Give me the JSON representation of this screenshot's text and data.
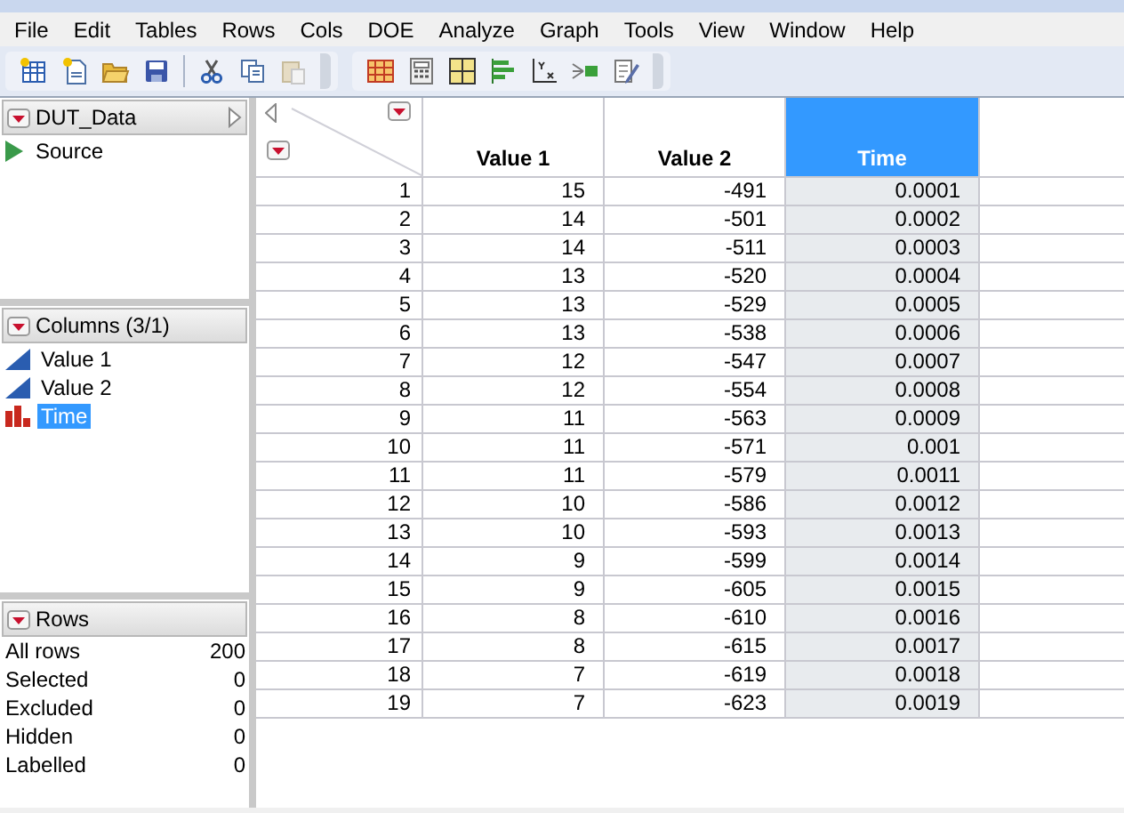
{
  "menu": [
    "File",
    "Edit",
    "Tables",
    "Rows",
    "Cols",
    "DOE",
    "Analyze",
    "Graph",
    "Tools",
    "View",
    "Window",
    "Help"
  ],
  "table_panel": {
    "title": "DUT_Data",
    "items": [
      {
        "label": "Source"
      }
    ]
  },
  "columns_panel": {
    "title": "Columns (3/1)",
    "columns": [
      {
        "label": "Value 1",
        "kind": "continuous",
        "selected": false
      },
      {
        "label": "Value 2",
        "kind": "continuous",
        "selected": false
      },
      {
        "label": "Time",
        "kind": "ordinal",
        "selected": true
      }
    ]
  },
  "rows_panel": {
    "title": "Rows",
    "stats": [
      {
        "label": "All rows",
        "value": "200"
      },
      {
        "label": "Selected",
        "value": "0"
      },
      {
        "label": "Excluded",
        "value": "0"
      },
      {
        "label": "Hidden",
        "value": "0"
      },
      {
        "label": "Labelled",
        "value": "0"
      }
    ]
  },
  "table": {
    "columns": [
      {
        "label": "Value 1",
        "selected": false
      },
      {
        "label": "Value 2",
        "selected": false
      },
      {
        "label": "Time",
        "selected": true
      }
    ],
    "rows": [
      [
        "1",
        "15",
        "-491",
        "0.0001"
      ],
      [
        "2",
        "14",
        "-501",
        "0.0002"
      ],
      [
        "3",
        "14",
        "-511",
        "0.0003"
      ],
      [
        "4",
        "13",
        "-520",
        "0.0004"
      ],
      [
        "5",
        "13",
        "-529",
        "0.0005"
      ],
      [
        "6",
        "13",
        "-538",
        "0.0006"
      ],
      [
        "7",
        "12",
        "-547",
        "0.0007"
      ],
      [
        "8",
        "12",
        "-554",
        "0.0008"
      ],
      [
        "9",
        "11",
        "-563",
        "0.0009"
      ],
      [
        "10",
        "11",
        "-571",
        "0.001"
      ],
      [
        "11",
        "11",
        "-579",
        "0.0011"
      ],
      [
        "12",
        "10",
        "-586",
        "0.0012"
      ],
      [
        "13",
        "10",
        "-593",
        "0.0013"
      ],
      [
        "14",
        "9",
        "-599",
        "0.0014"
      ],
      [
        "15",
        "9",
        "-605",
        "0.0015"
      ],
      [
        "16",
        "8",
        "-610",
        "0.0016"
      ],
      [
        "17",
        "8",
        "-615",
        "0.0017"
      ],
      [
        "18",
        "7",
        "-619",
        "0.0018"
      ],
      [
        "19",
        "7",
        "-623",
        "0.0019"
      ]
    ]
  }
}
